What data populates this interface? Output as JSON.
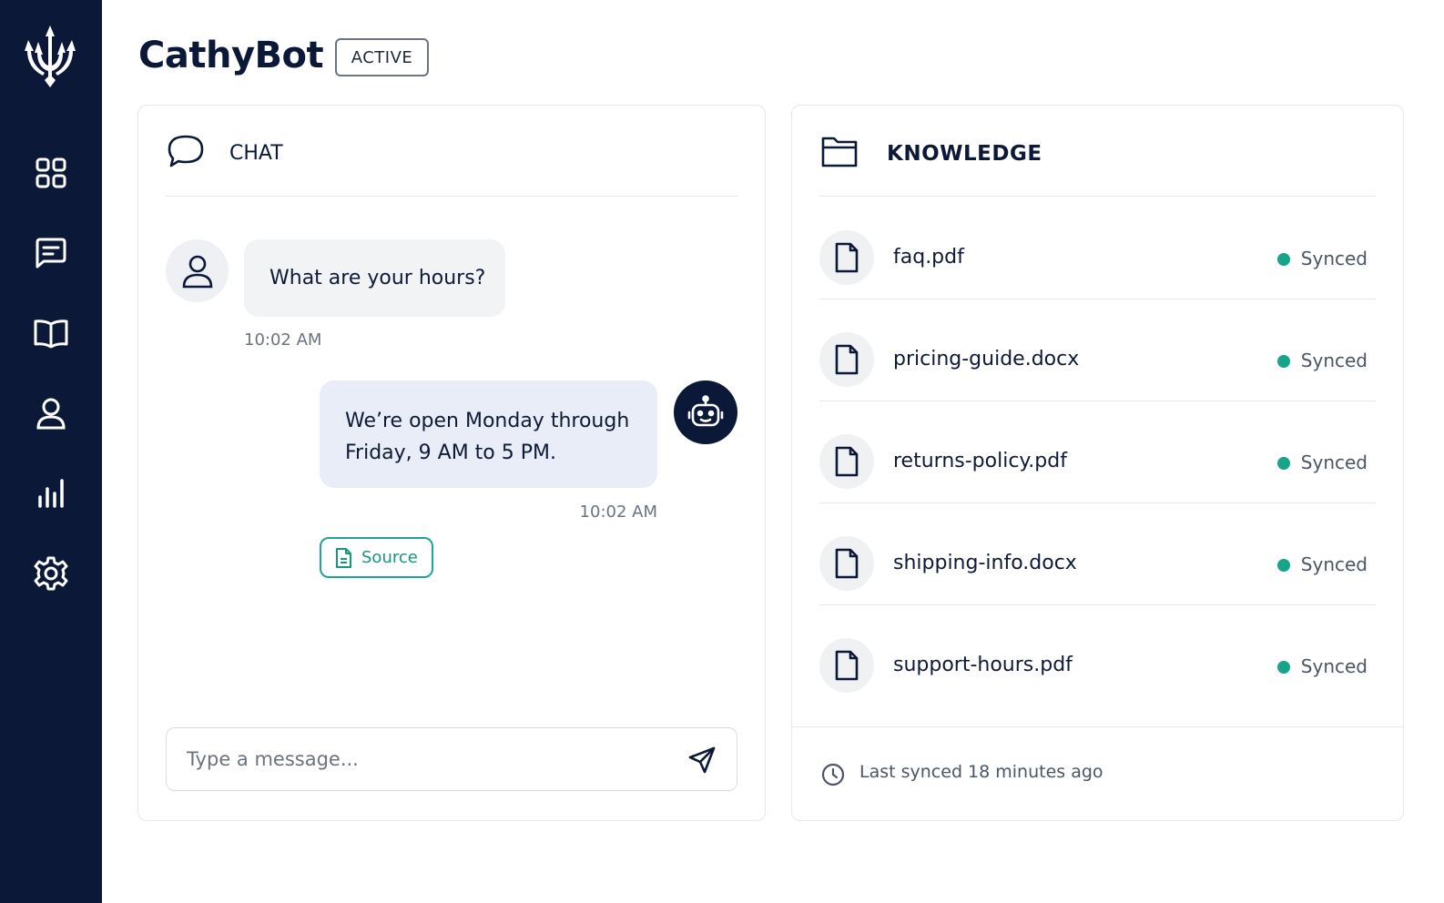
{
  "app": {
    "title": "CathyBot",
    "status": "ACTIVE"
  },
  "sidebar": {
    "logo": "trident-logo",
    "items": [
      {
        "name": "dashboard",
        "icon": "grid-icon"
      },
      {
        "name": "messages",
        "icon": "message-square-icon"
      },
      {
        "name": "knowledge",
        "icon": "book-open-icon"
      },
      {
        "name": "users",
        "icon": "user-icon"
      },
      {
        "name": "analytics",
        "icon": "bar-chart-icon"
      },
      {
        "name": "settings",
        "icon": "gear-icon"
      }
    ]
  },
  "chat": {
    "title": "CHAT",
    "messages": [
      {
        "sender": "user",
        "text": "What are your hours?",
        "time": "10:02 AM"
      },
      {
        "sender": "bot",
        "lines": [
          "We’re open Monday through",
          "Friday, 9 AM to 5 PM."
        ],
        "time": "10:02 AM",
        "source_label": "Source"
      }
    ],
    "input": {
      "placeholder": "Type a message...",
      "value": ""
    }
  },
  "knowledge": {
    "title": "KNOWLEDGE",
    "files": [
      {
        "name": "faq.pdf",
        "status": "Synced"
      },
      {
        "name": "pricing-guide.docx",
        "status": "Synced"
      },
      {
        "name": "returns-policy.pdf",
        "status": "Synced"
      },
      {
        "name": "shipping-info.docx",
        "status": "Synced"
      },
      {
        "name": "support-hours.pdf",
        "status": "Synced"
      }
    ],
    "footer": "Last synced 18 minutes ago"
  },
  "colors": {
    "sidebar": "#0b1838",
    "accent_green": "#17a58a",
    "bot_bubble": "#e8edf7",
    "user_bubble": "#f2f3f5"
  }
}
